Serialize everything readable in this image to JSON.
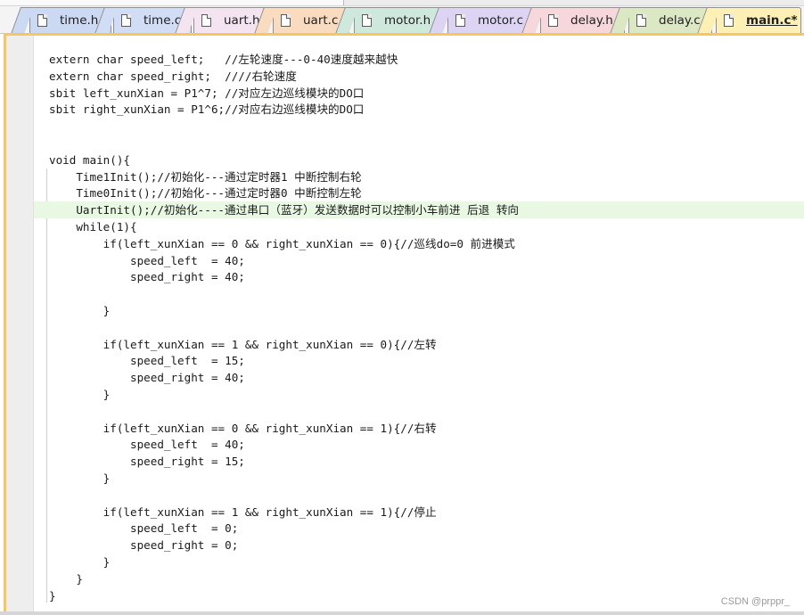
{
  "tabs": [
    {
      "label": "time.h",
      "color": "#ccd9f2",
      "active": false
    },
    {
      "label": "time.c",
      "color": "#d1ddf5",
      "active": false
    },
    {
      "label": "uart.h",
      "color": "#f4e3f0",
      "active": false
    },
    {
      "label": "uart.c",
      "color": "#f9dcc0",
      "active": false
    },
    {
      "label": "motor.h",
      "color": "#cfe8dd",
      "active": false
    },
    {
      "label": "motor.c",
      "color": "#dcd4f2",
      "active": false
    },
    {
      "label": "delay.h",
      "color": "#f6d7db",
      "active": false
    },
    {
      "label": "delay.c",
      "color": "#dbe8c3",
      "active": false
    },
    {
      "label": "main.c*",
      "color": "#fdf0b4",
      "active": true
    }
  ],
  "editor": {
    "current_line_index": 9,
    "lines": [
      "extern char speed_left;   //左轮速度---0-40速度越来越快",
      "extern char speed_right;  ////右轮速度",
      "sbit left_xunXian = P1^7; //对应左边巡线模块的DO口",
      "sbit right_xunXian = P1^6;//对应右边巡线模块的DO口",
      "",
      "",
      "void main(){",
      "    Time1Init();//初始化---通过定时器1 中断控制右轮",
      "    Time0Init();//初始化---通过定时器0 中断控制左轮",
      "    UartInit();//初始化----通过串口（蓝牙）发送数据时可以控制小车前进 后退 转向",
      "    while(1){",
      "        if(left_xunXian == 0 && right_xunXian == 0){//巡线do=0 前进模式",
      "            speed_left  = 40;",
      "            speed_right = 40;",
      "",
      "        }",
      "",
      "        if(left_xunXian == 1 && right_xunXian == 0){//左转",
      "            speed_left  = 15;",
      "            speed_right = 40;",
      "        }",
      "",
      "        if(left_xunXian == 0 && right_xunXian == 1){//右转",
      "            speed_left  = 40;",
      "            speed_right = 15;",
      "        }",
      "",
      "        if(left_xunXian == 1 && right_xunXian == 1){//停止",
      "            speed_left  = 0;",
      "            speed_right = 0;",
      "        }",
      "    }",
      "}"
    ]
  },
  "colors": {
    "active_border": "#f7c75d",
    "current_line": "#e8f8e2"
  },
  "watermark": "CSDN @prppr_"
}
